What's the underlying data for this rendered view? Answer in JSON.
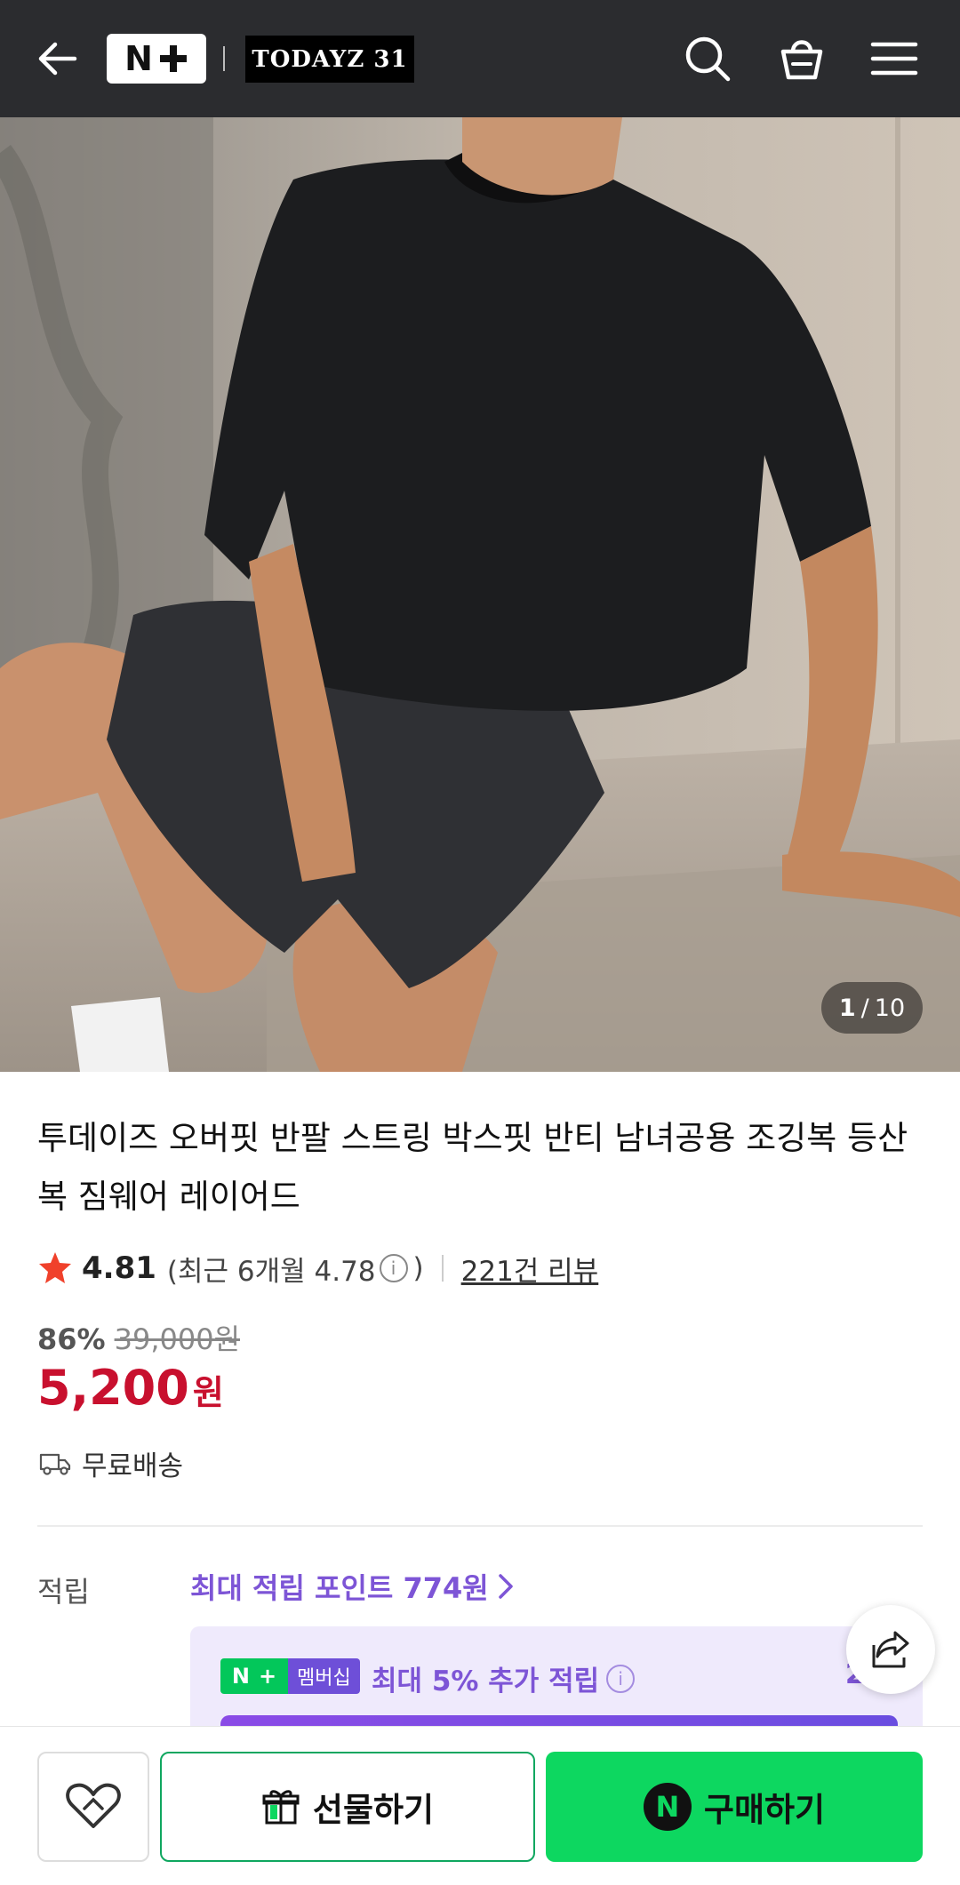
{
  "header": {
    "logo_text": "N+",
    "store_name": "TODAYZ 31",
    "icons": [
      "back-arrow-icon",
      "search-icon",
      "shopping-bag-icon",
      "menu-icon"
    ]
  },
  "gallery": {
    "current": "1",
    "separator": "/",
    "total": "10"
  },
  "product": {
    "title": "투데이즈 오버핏 반팔 스트링 박스핏 반티 남녀공용 조깅복 등산복 짐웨어 레이어드",
    "rating": "4.81",
    "recent_rating": "(최근 6개월 4.78",
    "recent_rating_close": ")",
    "review_count": "221건 리뷰",
    "discount_rate": "86%",
    "original_price": "39,000원",
    "price": "5,200",
    "price_unit": "원",
    "shipping": "무료배송"
  },
  "points": {
    "label": "적립",
    "max_points": "최대 적립 포인트 774원",
    "membership_badge": "멤버십",
    "membership_text": "최대 5% 추가 적립",
    "membership_amount": "20"
  },
  "actions": {
    "gift_label": "선물하기",
    "buy_label": "구매하기",
    "buy_badge": "N"
  },
  "colors": {
    "header_bg": "#2b2c2f",
    "price_red": "#c8102e",
    "point_purple": "#7d55d6",
    "naver_green": "#0dd760"
  }
}
